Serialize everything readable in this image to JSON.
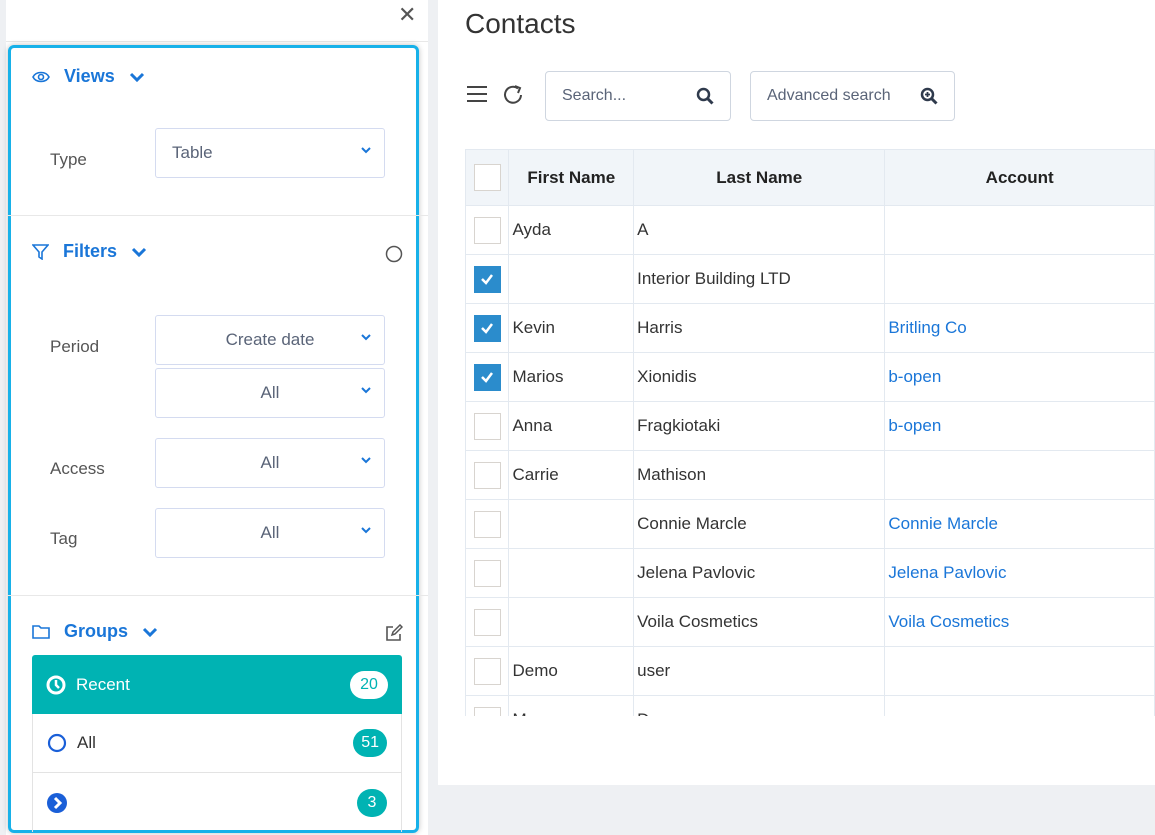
{
  "sidebar": {
    "close_icon": "close-icon",
    "views": {
      "title": "Views",
      "type_label": "Type",
      "type_value": "Table"
    },
    "filters": {
      "title": "Filters",
      "period_label": "Period",
      "period_field": "Create date",
      "period_range": "All",
      "access_label": "Access",
      "access_value": "All",
      "tag_label": "Tag",
      "tag_value": "All"
    },
    "groups": {
      "title": "Groups",
      "items": [
        {
          "label": "Recent",
          "count": "20",
          "icon": "clock-icon",
          "active": true
        },
        {
          "label": "All",
          "count": "51",
          "icon": "circle-icon"
        },
        {
          "label": "",
          "count": "3",
          "icon": "chevron-circle-right-icon"
        }
      ]
    }
  },
  "highlight_color": "#17b1e9",
  "main": {
    "title": "Contacts",
    "search_placeholder": "Search...",
    "advanced_search": "Advanced search",
    "columns": [
      "First Name",
      "Last Name",
      "Account"
    ],
    "rows": [
      {
        "first": "Ayda",
        "last": "A",
        "account": "",
        "checked": false
      },
      {
        "first": "",
        "last": "Interior Building LTD",
        "account": "",
        "checked": true
      },
      {
        "first": "Kevin",
        "last": "Harris",
        "account": "Britling Co",
        "checked": true
      },
      {
        "first": "Marios",
        "last": "Xionidis",
        "account": "b-open",
        "checked": true
      },
      {
        "first": "Anna",
        "last": "Fragkiotaki",
        "account": "b-open",
        "checked": false
      },
      {
        "first": "Carrie",
        "last": "Mathison",
        "account": "",
        "checked": false
      },
      {
        "first": "",
        "last": "Connie Marcle",
        "account": "Connie Marcle",
        "checked": false
      },
      {
        "first": "",
        "last": "Jelena Pavlovic",
        "account": "Jelena Pavlovic",
        "checked": false
      },
      {
        "first": "",
        "last": "Voila Cosmetics",
        "account": "Voila Cosmetics",
        "checked": false
      },
      {
        "first": "Demo",
        "last": "user",
        "account": "",
        "checked": false
      },
      {
        "first": "Mary",
        "last": "Dawson",
        "account": "",
        "checked": false
      }
    ]
  }
}
